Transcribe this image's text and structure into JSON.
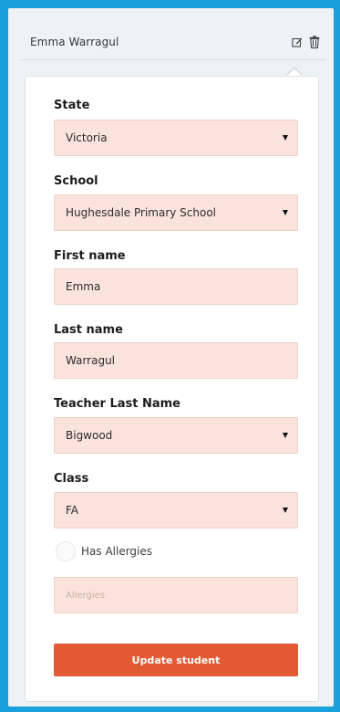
{
  "header": {
    "student_name": "Emma Warragul",
    "edit_icon": "edit-icon",
    "delete_icon": "trash-icon"
  },
  "form": {
    "state": {
      "label": "State",
      "value": "Victoria"
    },
    "school": {
      "label": "School",
      "value": "Hughesdale Primary School"
    },
    "first_name": {
      "label": "First name",
      "value": "Emma"
    },
    "last_name": {
      "label": "Last name",
      "value": "Warragul"
    },
    "teacher_last_name": {
      "label": "Teacher Last Name",
      "value": "Bigwood"
    },
    "class": {
      "label": "Class",
      "value": "FA"
    },
    "has_allergies": {
      "label": "Has Allergies",
      "checked": false
    },
    "allergies_placeholder": "Allergies",
    "submit_label": "Update student"
  },
  "colors": {
    "background": "#1aa0dc",
    "panel": "#eef2f5",
    "field": "#f9e3dc",
    "accent": "#e15a33"
  }
}
